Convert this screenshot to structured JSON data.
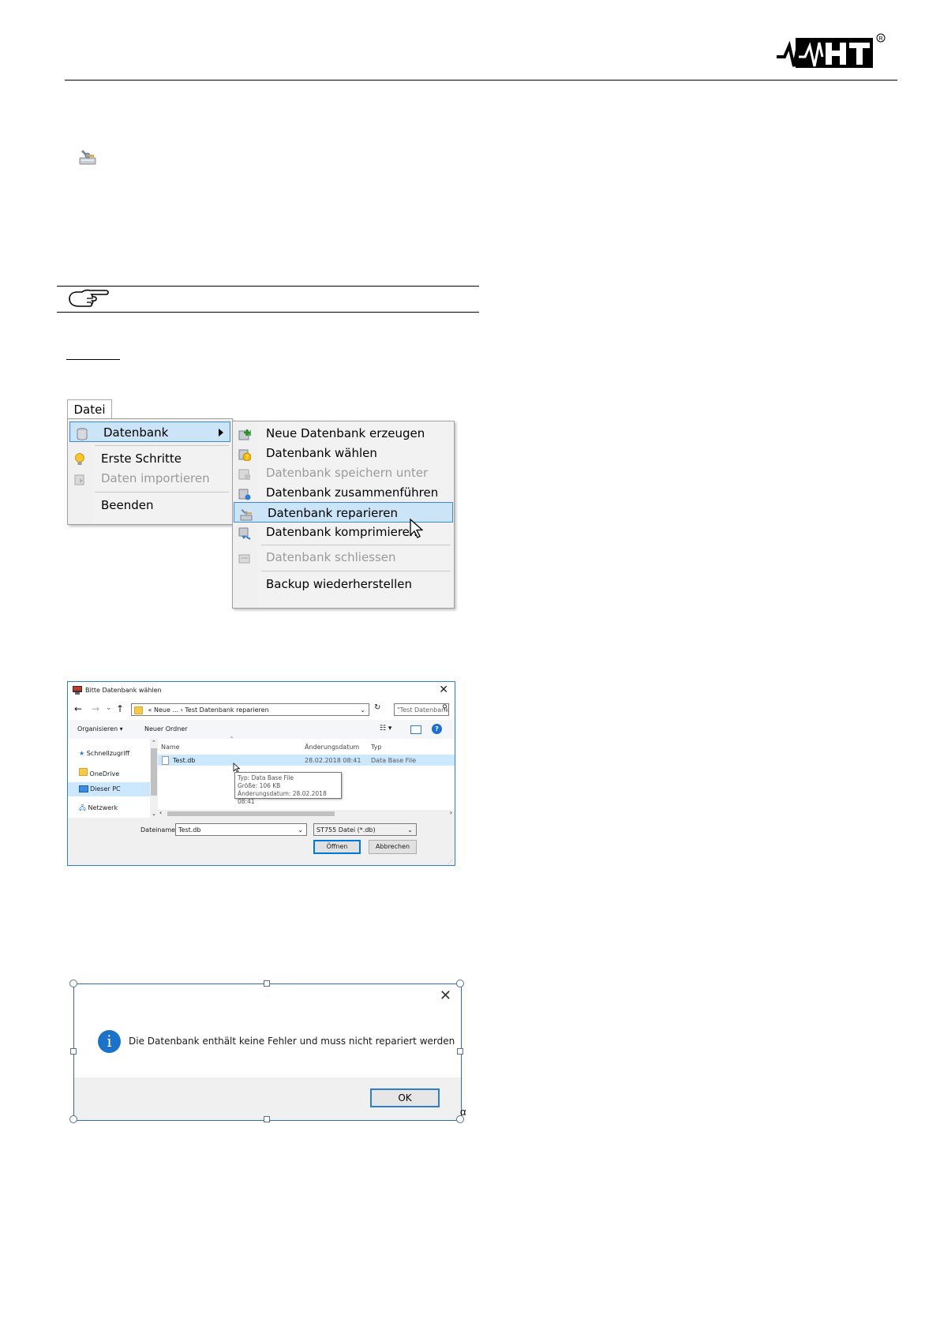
{
  "colors": {
    "accent": "#0078d7",
    "highlight": "#cce4f7",
    "info_icon": "#1a73c8"
  },
  "menu": {
    "tab_label": "Datei",
    "main_items": [
      {
        "label": "Datenbank",
        "icon": "database-icon",
        "state": "highlighted",
        "has_submenu": true
      },
      {
        "label": "Erste Schritte",
        "icon": "lightbulb-icon",
        "state": "normal"
      },
      {
        "label": "Daten importieren",
        "icon": "import-icon",
        "state": "disabled"
      },
      {
        "label": "Beenden",
        "icon": "",
        "state": "normal"
      }
    ],
    "sub_items": [
      {
        "label": "Neue Datenbank erzeugen",
        "icon": "new-database-icon",
        "state": "normal"
      },
      {
        "label": "Datenbank wählen",
        "icon": "choose-database-icon",
        "state": "normal"
      },
      {
        "label": "Datenbank speichern unter",
        "icon": "save-database-icon",
        "state": "disabled"
      },
      {
        "label": "Datenbank zusammenführen",
        "icon": "merge-database-icon",
        "state": "normal"
      },
      {
        "label": "Datenbank reparieren",
        "icon": "repair-database-icon",
        "state": "highlighted"
      },
      {
        "label": "Datenbank komprimieren",
        "icon": "compress-database-icon",
        "state": "normal"
      },
      {
        "label": "Datenbank schliessen",
        "icon": "close-database-icon",
        "state": "disabled"
      },
      {
        "label": "Backup wiederherstellen",
        "icon": "",
        "state": "normal"
      }
    ]
  },
  "file_dialog": {
    "title": "Bitte Datenbank wählen",
    "breadcrumb": [
      "«",
      "Neue ...",
      "›",
      "Test Datenbank reparieren"
    ],
    "search_placeholder": "\"Test Datenbank reparieren\" d...",
    "organize_label": "Organisieren ▾",
    "new_folder_label": "Neuer Ordner",
    "nav_items": [
      {
        "label": "Schnellzugriff",
        "icon": "star-icon",
        "selected": false
      },
      {
        "label": "OneDrive",
        "icon": "folder-icon",
        "selected": false
      },
      {
        "label": "Dieser PC",
        "icon": "computer-icon",
        "selected": true
      },
      {
        "label": "Netzwerk",
        "icon": "network-icon",
        "selected": false
      }
    ],
    "columns": [
      "Name",
      "Änderungsdatum",
      "Typ"
    ],
    "files": [
      {
        "name": "Test.db",
        "date": "28.02.2018 08:41",
        "type": "Data Base File"
      }
    ],
    "tooltip": [
      "Typ: Data Base File",
      "Größe: 106 KB",
      "Änderungsdatum: 28.02.2018 08:41"
    ],
    "filename_label": "Dateiname:",
    "filename_value": "Test.db",
    "filter_value": "ST755 Datei (*.db)",
    "open_label": "Öffnen",
    "cancel_label": "Abbrechen"
  },
  "message_box": {
    "text": "Die Datenbank enthält keine Fehler und muss nicht repariert werden",
    "ok_label": "OK",
    "anchor_mark": "α"
  }
}
